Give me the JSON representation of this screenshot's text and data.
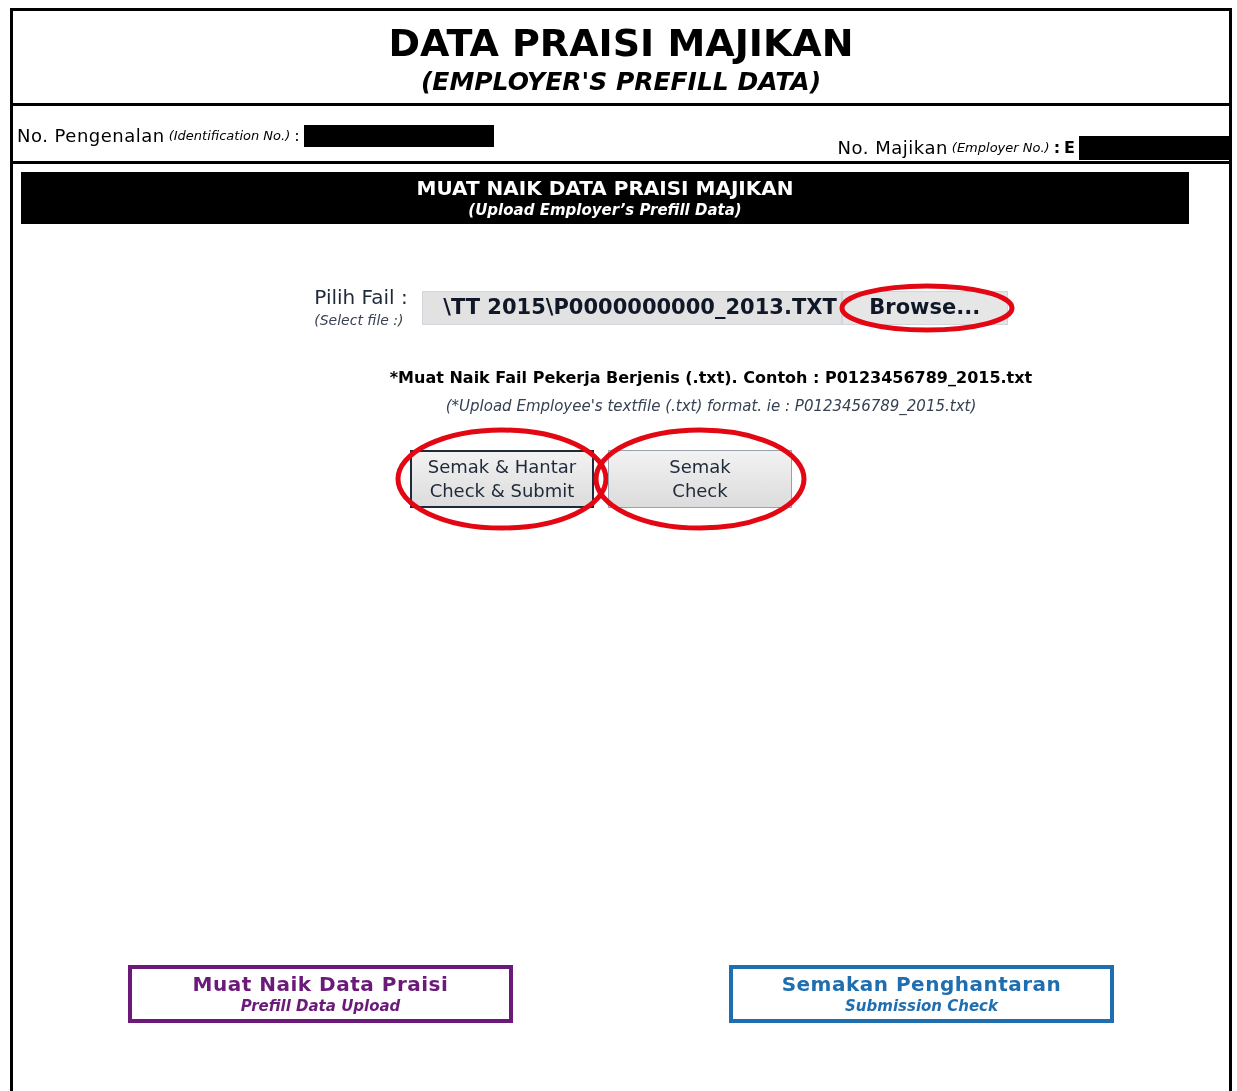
{
  "title": "DATA PRAISI MAJIKAN",
  "subtitle": "(EMPLOYER'S PREFILL DATA)",
  "identification": {
    "label": "No. Pengenalan",
    "label_en": "(Identification No.)",
    "colon": ":",
    "redacted": true
  },
  "employer": {
    "label": "No. Majikan",
    "label_en": "(Employer No.)",
    "colon": ":",
    "value": "E",
    "redacted": true
  },
  "banner": {
    "title": "MUAT NAIK DATA PRAISI MAJIKAN",
    "subtitle": "(Upload Employer’s Prefill Data)"
  },
  "file_picker": {
    "label": "Pilih Fail :",
    "label_en": "(Select file :)",
    "value": "\\TT 2015\\P0000000000_2013.TXT",
    "button": "Browse...",
    "highlighted": true
  },
  "note": "*Muat Naik Fail Pekerja Berjenis (.txt). Contoh : P0123456789_2015.txt",
  "note_en": "(*Upload Employee's textfile (.txt) format. ie : P0123456789_2015.txt)",
  "buttons": [
    {
      "line1": "Semak & Hantar",
      "line2": "Check & Submit",
      "focused": true,
      "highlighted": true
    },
    {
      "line1": "Semak",
      "line2": "Check",
      "focused": false,
      "highlighted": true
    }
  ],
  "links": [
    {
      "title": "Muat Naik Data Praisi",
      "subtitle": "Prefill Data Upload",
      "color": "#6b1a7a"
    },
    {
      "title": "Semakan Penghantaran",
      "subtitle": "Submission Check",
      "color": "#1f6fb0"
    }
  ]
}
